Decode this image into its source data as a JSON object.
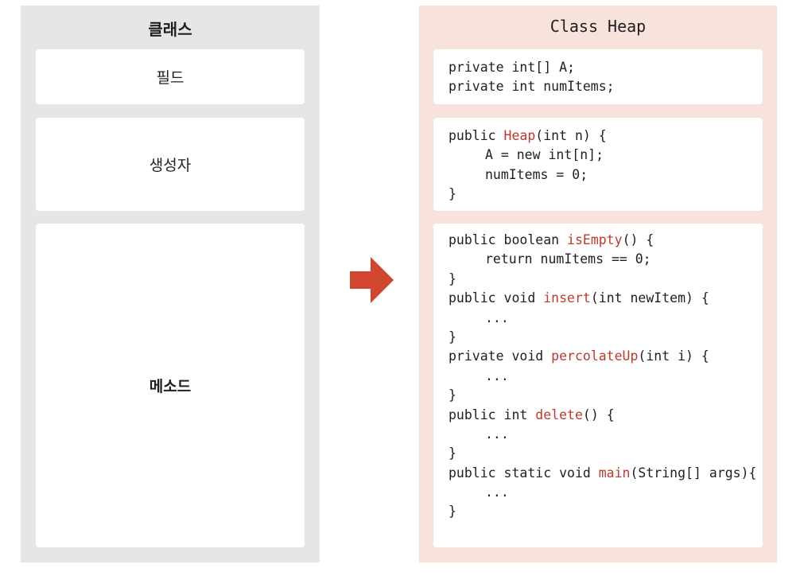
{
  "left": {
    "title": "클래스",
    "field_label": "필드",
    "constructor_label": "생성자",
    "method_label": "메소드"
  },
  "right": {
    "title": "Class Heap",
    "fields": [
      {
        "pre": "private int[] A;",
        "name": "",
        "post": "",
        "indent": false
      },
      {
        "pre": "private int numItems;",
        "name": "",
        "post": "",
        "indent": false
      }
    ],
    "constructor": [
      {
        "pre": "public ",
        "name": "Heap",
        "post": "(int n) {",
        "indent": false
      },
      {
        "pre": "A = new int[n];",
        "name": "",
        "post": "",
        "indent": true
      },
      {
        "pre": "numItems = 0;",
        "name": "",
        "post": "",
        "indent": true
      },
      {
        "pre": "}",
        "name": "",
        "post": "",
        "indent": false
      }
    ],
    "methods": [
      {
        "pre": "public boolean ",
        "name": "isEmpty",
        "post": "() {",
        "indent": false
      },
      {
        "pre": "return numItems == 0;",
        "name": "",
        "post": "",
        "indent": true
      },
      {
        "pre": "}",
        "name": "",
        "post": "",
        "indent": false
      },
      {
        "pre": "public void ",
        "name": "insert",
        "post": "(int newItem) {",
        "indent": false
      },
      {
        "pre": "...",
        "name": "",
        "post": "",
        "indent": true
      },
      {
        "pre": "}",
        "name": "",
        "post": "",
        "indent": false
      },
      {
        "pre": "private void ",
        "name": "percolateUp",
        "post": "(int i) {",
        "indent": false
      },
      {
        "pre": "...",
        "name": "",
        "post": "",
        "indent": true
      },
      {
        "pre": "}",
        "name": "",
        "post": "",
        "indent": false
      },
      {
        "pre": "public int ",
        "name": "delete",
        "post": "() {",
        "indent": false
      },
      {
        "pre": "...",
        "name": "",
        "post": "",
        "indent": true
      },
      {
        "pre": "}",
        "name": "",
        "post": "",
        "indent": false
      },
      {
        "pre": "public static void ",
        "name": "main",
        "post": "(String[] args){",
        "indent": false
      },
      {
        "pre": "...",
        "name": "",
        "post": "",
        "indent": true
      },
      {
        "pre": "}",
        "name": "",
        "post": "",
        "indent": false
      }
    ]
  },
  "colors": {
    "left_panel": "#e6e6e6",
    "right_panel": "#f8e3dc",
    "highlight": "#c0392b",
    "arrow": "#d2462f"
  },
  "icons": {
    "arrow": "right-arrow-icon"
  }
}
